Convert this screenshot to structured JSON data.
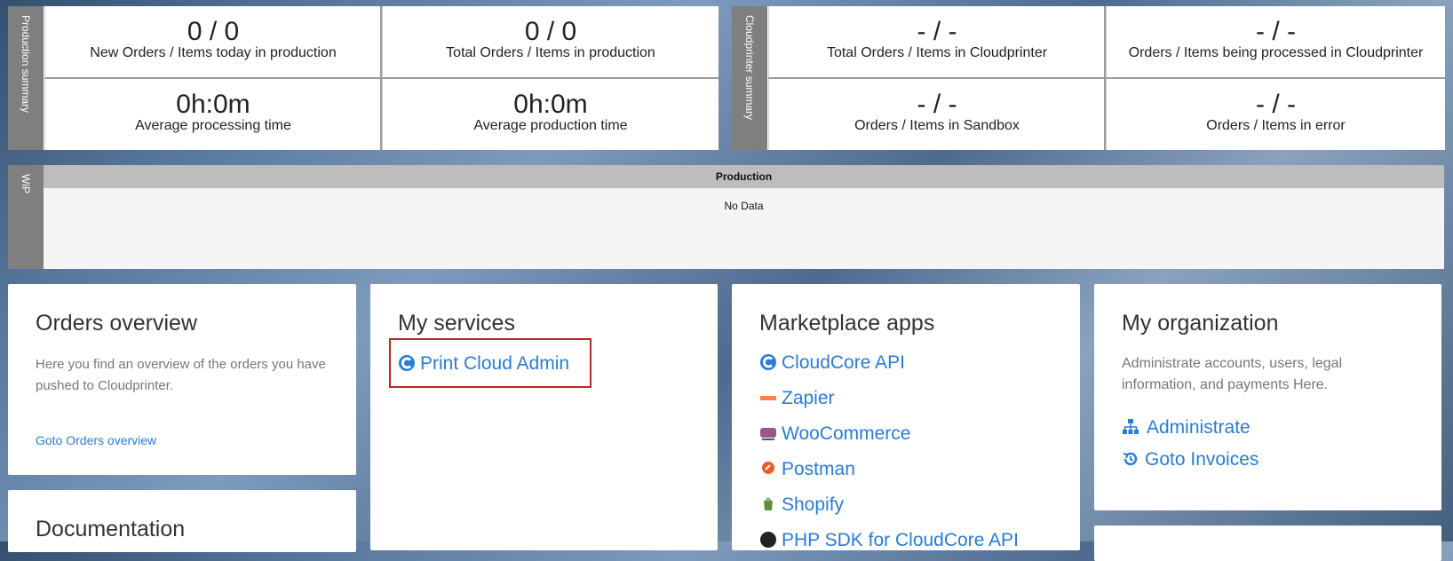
{
  "production_summary": {
    "tab": "Production summary",
    "cells": [
      {
        "value": "0 / 0",
        "label": "New Orders / Items today in production"
      },
      {
        "value": "0 / 0",
        "label": "Total Orders / Items in production"
      },
      {
        "value": "0h:0m",
        "label": "Average processing time"
      },
      {
        "value": "0h:0m",
        "label": "Average production time"
      }
    ]
  },
  "cloudprinter_summary": {
    "tab": "Cloudprinter summary",
    "cells": [
      {
        "value": "- / -",
        "label": "Total Orders / Items in Cloudprinter"
      },
      {
        "value": "- / -",
        "label": "Orders / Items being processed in Cloudprinter"
      },
      {
        "value": "- / -",
        "label": "Orders / Items in Sandbox"
      },
      {
        "value": "- / -",
        "label": "Orders / Items in error"
      }
    ]
  },
  "wip": {
    "tab": "WiP",
    "header": "Production",
    "empty": "No Data"
  },
  "orders_overview": {
    "title": "Orders overview",
    "text": "Here you find an overview of the orders you have pushed to Cloudprinter.",
    "link": "Goto Orders overview"
  },
  "documentation": {
    "title": "Documentation"
  },
  "my_services": {
    "title": "My services",
    "items": [
      {
        "label": "Print Cloud Admin",
        "icon": "cloudprinter-logo-icon"
      }
    ]
  },
  "marketplace": {
    "title": "Marketplace apps",
    "items": [
      {
        "label": "CloudCore API",
        "icon": "cloudprinter-logo-icon"
      },
      {
        "label": "Zapier",
        "icon": "zapier-icon"
      },
      {
        "label": "WooCommerce",
        "icon": "woocommerce-icon"
      },
      {
        "label": "Postman",
        "icon": "postman-icon"
      },
      {
        "label": "Shopify",
        "icon": "shopify-icon"
      },
      {
        "label": "PHP SDK for CloudCore API",
        "icon": "github-icon"
      }
    ]
  },
  "my_organization": {
    "title": "My organization",
    "text": "Administrate accounts, users, legal information, and payments Here.",
    "links": [
      {
        "label": "Administrate",
        "icon": "sitemap-icon"
      },
      {
        "label": "Goto Invoices",
        "icon": "history-icon"
      }
    ]
  },
  "colors": {
    "link": "#2a7bd4",
    "tab": "#7f7f7f",
    "highlight": "#b52828"
  }
}
